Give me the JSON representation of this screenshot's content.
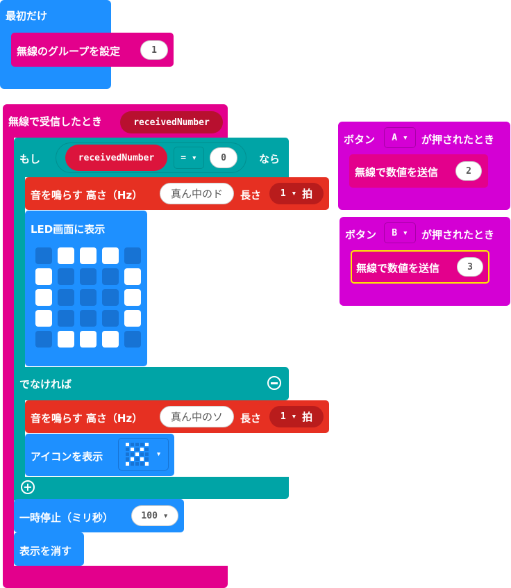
{
  "colors": {
    "radio": "#e3008c",
    "logic": "#00a4a6",
    "music": "#e63022",
    "basic": "#1e90ff",
    "input": "#d400d4",
    "variable": "#dc143c"
  },
  "on_start": {
    "label": "最初だけ",
    "set_group": {
      "label": "無線のグループを設定",
      "value": "1"
    }
  },
  "on_received": {
    "label": "無線で受信したとき",
    "param": "receivedNumber",
    "if": {
      "label": "もし",
      "var": "receivedNumber",
      "op": "=",
      "value": "0",
      "then": "なら",
      "tone1": {
        "label": "音を鳴らす 高さ（Hz）",
        "note": "真ん中のド",
        "beat_label": "長さ",
        "beat": "1",
        "beat_unit": "拍"
      },
      "show_leds": {
        "label": "LED画面に表示",
        "leds": [
          [
            0,
            1,
            1,
            1,
            0
          ],
          [
            1,
            0,
            0,
            0,
            1
          ],
          [
            1,
            0,
            0,
            0,
            1
          ],
          [
            1,
            0,
            0,
            0,
            1
          ],
          [
            0,
            1,
            1,
            1,
            0
          ]
        ]
      },
      "else": "でなければ",
      "tone2": {
        "label": "音を鳴らす 高さ（Hz）",
        "note": "真ん中のソ",
        "beat_label": "長さ",
        "beat": "1",
        "beat_unit": "拍"
      },
      "show_icon": {
        "label": "アイコンを表示",
        "icon": "no-icon",
        "icon_leds": [
          [
            1,
            0,
            0,
            0,
            1
          ],
          [
            0,
            1,
            0,
            1,
            0
          ],
          [
            0,
            0,
            1,
            0,
            0
          ],
          [
            0,
            1,
            0,
            1,
            0
          ],
          [
            1,
            0,
            0,
            0,
            1
          ]
        ]
      }
    },
    "pause": {
      "label": "一時停止（ミリ秒）",
      "value": "100"
    },
    "clear": {
      "label": "表示を消す"
    }
  },
  "button_a": {
    "label_pre": "ボタン",
    "button": "A",
    "label_post": "が押されたとき",
    "send": {
      "label": "無線で数値を送信",
      "value": "2"
    }
  },
  "button_b": {
    "label_pre": "ボタン",
    "button": "B",
    "label_post": "が押されたとき",
    "send": {
      "label": "無線で数値を送信",
      "value": "3"
    }
  }
}
